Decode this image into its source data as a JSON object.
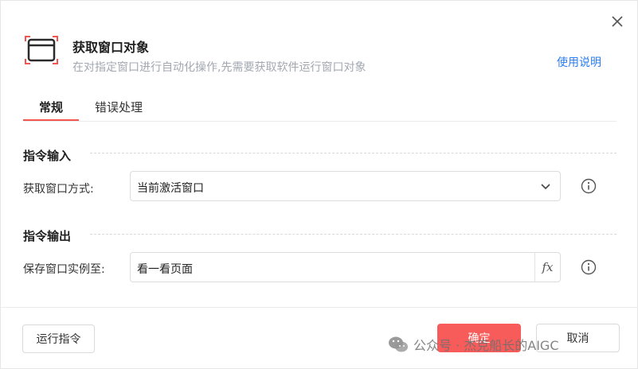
{
  "dialog": {
    "title": "获取窗口对象",
    "subtitle": "在对指定窗口进行自动化操作,先需要获取软件运行窗口对象",
    "help_link": "使用说明",
    "close_icon": "close-icon"
  },
  "tabs": [
    {
      "label": "常规",
      "active": true
    },
    {
      "label": "错误处理",
      "active": false
    }
  ],
  "input_section": {
    "title": "指令输入",
    "field_label": "获取窗口方式:",
    "select_value": "当前激活窗口"
  },
  "output_section": {
    "title": "指令输出",
    "field_label": "保存窗口实例至:",
    "input_value": "看一看页面",
    "fx_label": "fx"
  },
  "footer": {
    "run_label": "运行指令",
    "ok_label": "确定",
    "cancel_label": "取消"
  },
  "watermark": {
    "text": "公众号 · 杰克船长的AIGC"
  },
  "colors": {
    "accent": "#f2554f",
    "primary_button": "#f75c5a",
    "link": "#2d7df0",
    "muted_text": "#a3a8b0"
  }
}
